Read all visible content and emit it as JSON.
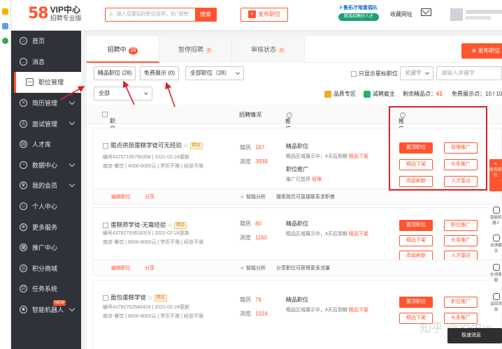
{
  "header": {
    "logo_num": "58",
    "logo_vip": "VIP中心",
    "logo_sub": "招聘专业版",
    "search_placeholder": "输入您要招的职位名称，如 \"销售\"",
    "search_btn": "搜索",
    "post_job": "发布职位",
    "banner_title": "卜鲁拓才暗重偶队",
    "banner_sub": "精准招聘好人才",
    "store_link": "收藏网址"
  },
  "sidebar": {
    "items": [
      {
        "label": "首页",
        "icon": "home-icon",
        "glyph": "⌂",
        "chev": false
      },
      {
        "label": "消息",
        "icon": "message-icon",
        "glyph": "…",
        "chev": false
      },
      {
        "label": "职位管理",
        "icon": "briefcase-icon",
        "glyph": "▭",
        "chev": false,
        "active": true
      },
      {
        "label": "简历管理",
        "icon": "resume-icon",
        "glyph": "≡",
        "chev": true
      },
      {
        "label": "面试管理",
        "icon": "interview-icon",
        "glyph": "♙",
        "chev": true
      },
      {
        "label": "人才库",
        "icon": "talent-icon",
        "glyph": "▤",
        "chev": false
      },
      {
        "label": "数据中心",
        "icon": "data-icon",
        "glyph": "◔",
        "chev": true
      },
      {
        "label": "我的会员",
        "icon": "crown-icon",
        "glyph": "♛",
        "chev": true
      },
      {
        "label": "个人中心",
        "icon": "user-icon",
        "glyph": "☺",
        "chev": false
      },
      {
        "label": "更多服务",
        "icon": "services-icon",
        "glyph": "⊕",
        "chev": false
      },
      {
        "label": "推广中心",
        "icon": "promotion-icon",
        "glyph": "▦",
        "chev": false
      },
      {
        "label": "积分商城",
        "icon": "points-icon",
        "glyph": "◎",
        "chev": false
      },
      {
        "label": "任务系统",
        "icon": "task-icon",
        "glyph": "☑",
        "chev": false
      },
      {
        "label": "智能机器人",
        "icon": "robot-icon",
        "glyph": "☻",
        "chev": true,
        "badge": "NEW"
      }
    ]
  },
  "tabs": [
    {
      "label": "招聘中",
      "count": "28"
    },
    {
      "label": "暂停招聘",
      "count": "0"
    },
    {
      "label": "审核状态",
      "count": "0"
    }
  ],
  "post_job_main": "发布职位",
  "filters": {
    "premium": "精品职位 (28)",
    "free": "免费展示 (0)",
    "all_jobs": "全部职位（28）",
    "only_star": "只显示星标职位",
    "keyword_type": "关键字",
    "keyword_placeholder": "请输入关键字",
    "all": "全部",
    "zone": "品质专区",
    "employer": "诚聘雇主",
    "remaining_label": "剩余精品点：",
    "remaining_value": "61",
    "free_label": "免费展示点：",
    "free_value": "10 / 10"
  },
  "table_head": {
    "info": "职位信息",
    "recruit": "招聘情况",
    "status": "推广状态",
    "manage": "推广管理"
  },
  "rows": [
    {
      "title": "甜点烘焙蛋糕学徒可无经验",
      "tag": "精品",
      "id_line": "编号43707155795358 | 2021-02-24更新",
      "detail": "南京-餐饮 | 4000-6000元 | 学历不限 | 经验不限",
      "resume_label": "简历",
      "resume": "167",
      "view_label": "浏览",
      "view": "3939",
      "promo1": "精品职位",
      "promo1_sub": "精品区域展示中，4天后到期",
      "renew": "精品下架",
      "promo2": "职位推广",
      "promo2_sub": "推广已暂停",
      "manage": "管理",
      "edit": "编辑职位",
      "share": "分享",
      "smart": "智能分析",
      "tip": "搜索简历可直接联系求职者",
      "btns": [
        "置顶职位",
        "管理推广",
        "精品下架",
        "头条推广",
        "高级刷新",
        "人才雷达"
      ]
    },
    {
      "title": "蛋糕师学徒-无需经验",
      "tag": "精品",
      "id_line": "编号43782753618319 | 2021-02-24更新",
      "detail": "南京-餐饮 | 6000-8000元 | 学历不限 | 经验不限",
      "resume_label": "简历",
      "resume": "80",
      "view_label": "浏览",
      "view": "1160",
      "promo1": "精品职位",
      "promo1_sub": "精品区域展示中，4天后到期",
      "renew": "精品下架",
      "edit": "编辑职位",
      "share": "分享",
      "smart": "智能分析",
      "tip": "分享职位可获得更多流量",
      "btns": [
        "置顶职位",
        "职位推广",
        "精品下架",
        "头条推广",
        "高级刷新",
        "人才雷达"
      ]
    },
    {
      "title": "面包蛋糕学徒",
      "tag": "精品",
      "id_line": "编号43782762540424 | 2021-02-24更新",
      "detail": "南京-餐饮 | 6000-8000元 | 学历不限 | 经验不限",
      "resume_label": "简历",
      "resume": "76",
      "view_label": "浏览",
      "view": "1024",
      "promo1": "精品职位",
      "promo1_sub": "精品区域展示中，4天后到期",
      "renew": "精品下架",
      "btns": [
        "置顶职位",
        "职位推广",
        "精品下架",
        "头条推广"
      ]
    }
  ],
  "float": {
    "top": "发布职位",
    "items": [
      "智能机器人",
      "反馈建议",
      "在线客服",
      "返回顶部"
    ]
  },
  "watermark": "知乎 @XYBin",
  "speed": "极速消息",
  "colors": {
    "accent": "#ff552e",
    "sidebar": "#2f3238",
    "annotation": "#d8232a"
  }
}
